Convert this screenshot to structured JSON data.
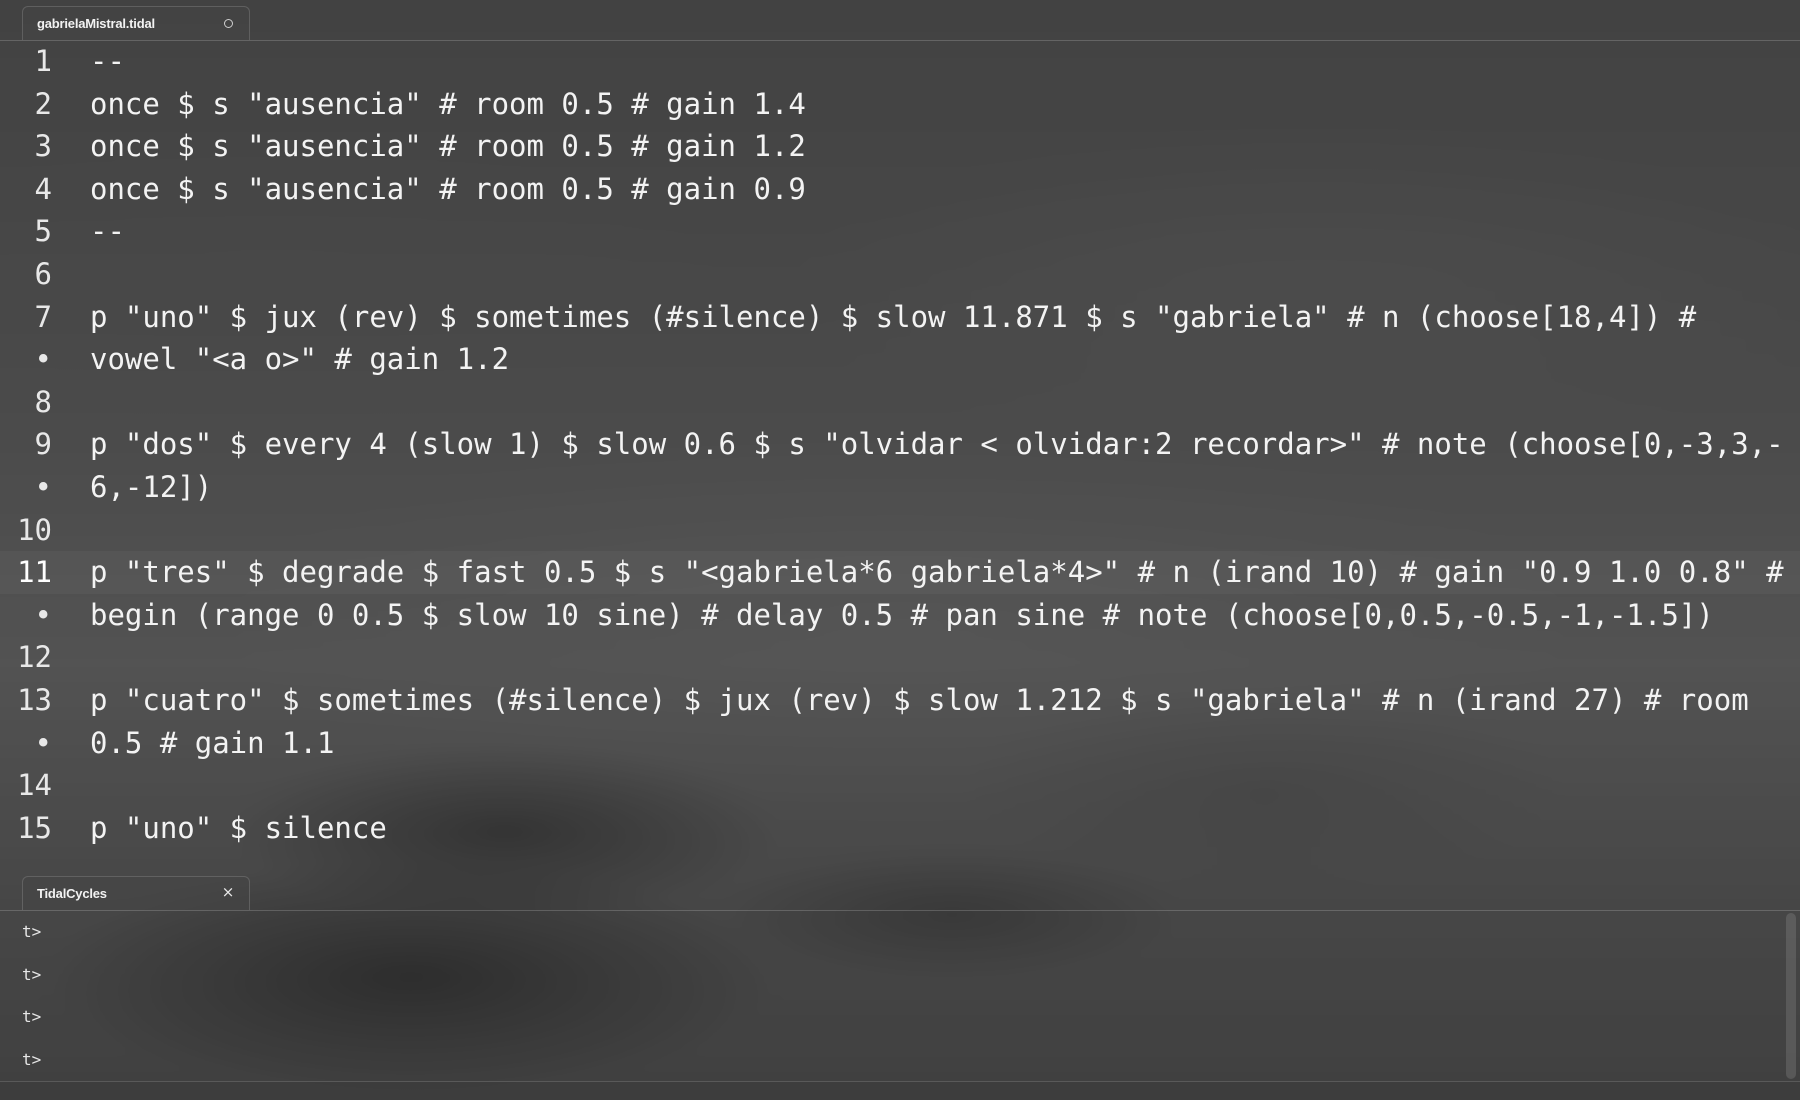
{
  "editor_tab": {
    "title": "gabrielaMistral.tidal"
  },
  "console_tab": {
    "title": "TidalCycles",
    "close_glyph": "×"
  },
  "editor": {
    "lines": [
      {
        "num": "1",
        "text": "--"
      },
      {
        "num": "2",
        "text": "once $ s \"ausencia\" # room 0.5 # gain 1.4"
      },
      {
        "num": "3",
        "text": "once $ s \"ausencia\" # room 0.5 # gain 1.2"
      },
      {
        "num": "4",
        "text": "once $ s \"ausencia\" # room 0.5 # gain 0.9"
      },
      {
        "num": "5",
        "text": "--"
      },
      {
        "num": "6",
        "text": ""
      },
      {
        "num": "7",
        "text": "p \"uno\" $ jux (rev) $ sometimes (#silence) $ slow 11.871 $ s \"gabriela\" # n (choose[18,4]) #"
      },
      {
        "num": "•",
        "text": "vowel \"<a o>\" # gain 1.2"
      },
      {
        "num": "8",
        "text": ""
      },
      {
        "num": "9",
        "text": "p \"dos\" $ every 4 (slow 1) $ slow 0.6 $ s \"olvidar < olvidar:2 recordar>\" # note (choose[0,-3,3,-"
      },
      {
        "num": "•",
        "text": "6,-12])"
      },
      {
        "num": "10",
        "text": ""
      },
      {
        "num": "11",
        "text": "p \"tres\" $ degrade $ fast 0.5 $ s \"<gabriela*6 gabriela*4>\" # n (irand 10) # gain \"0.9 1.0 0.8\" #"
      },
      {
        "num": "•",
        "text": "begin (range 0 0.5 $ slow 10 sine) # delay 0.5 # pan sine # note (choose[0,0.5,-0.5,-1,-1.5])"
      },
      {
        "num": "12",
        "text": ""
      },
      {
        "num": "13",
        "text": "p \"cuatro\" $ sometimes (#silence) $ jux (rev) $ slow 1.212 $ s \"gabriela\" # n (irand 27) # room"
      },
      {
        "num": "•",
        "text": "0.5 # gain 1.1"
      },
      {
        "num": "14",
        "text": ""
      },
      {
        "num": "15",
        "text": "p \"uno\" $ silence"
      }
    ]
  },
  "console": {
    "prompts": [
      "t>",
      "t>",
      "t>",
      "t>"
    ]
  }
}
